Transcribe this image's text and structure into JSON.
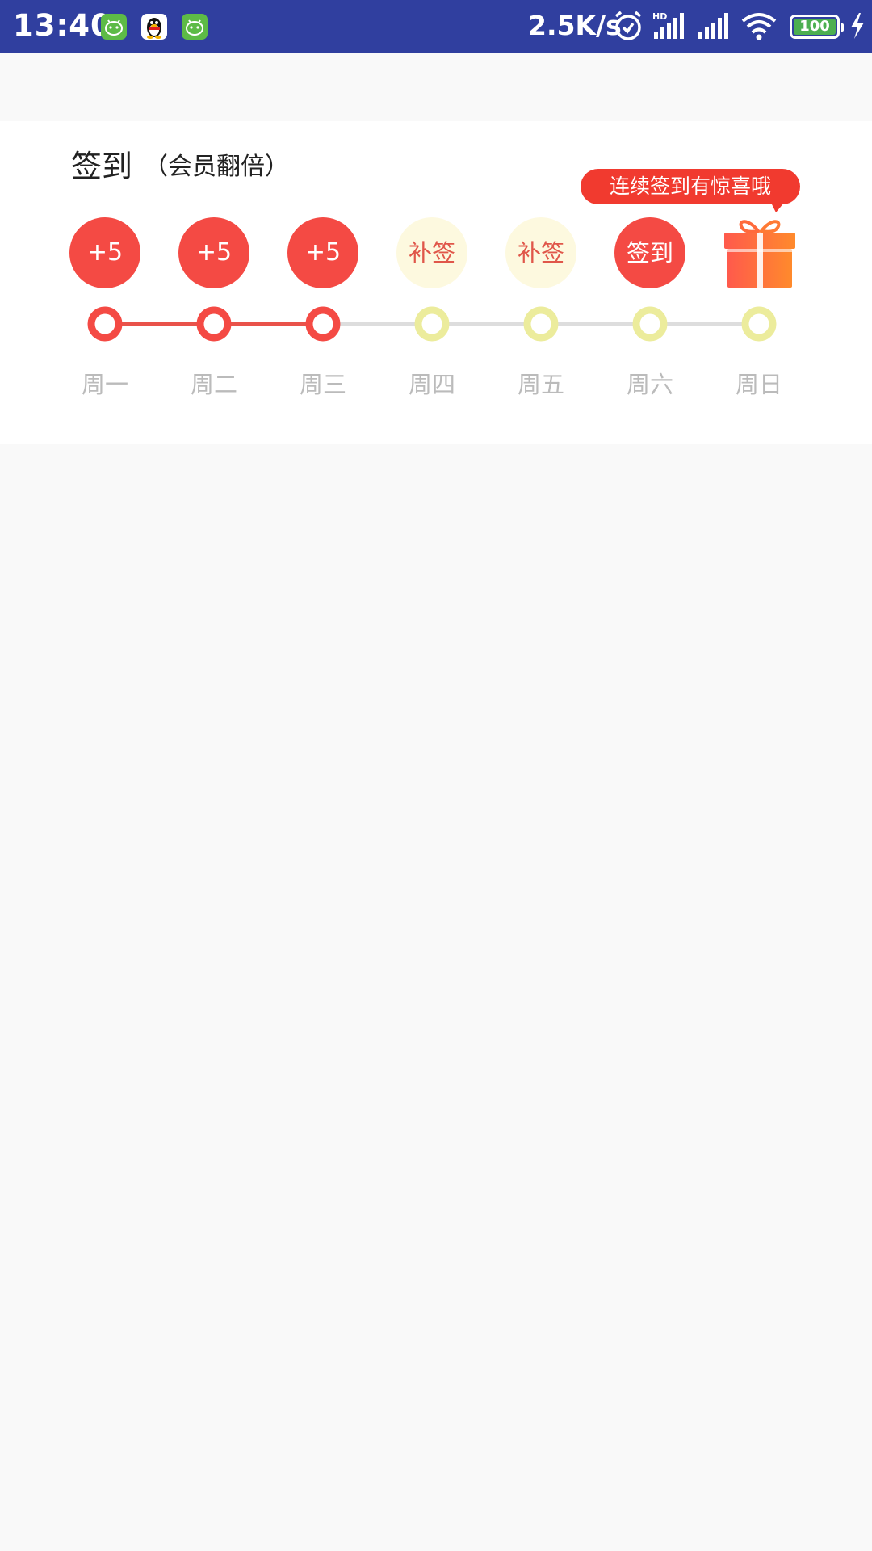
{
  "status_bar": {
    "time": "13:40",
    "speed": "2.5K/s",
    "battery_level": "100",
    "icons": [
      "android-app-icon",
      "qq-icon",
      "android-app-icon",
      "alarm-icon",
      "hd-signal-icon",
      "signal-icon",
      "wifi-icon",
      "battery-icon",
      "charging-icon"
    ]
  },
  "signin": {
    "title": "签到",
    "subtitle": "（会员翻倍）",
    "tooltip": "连续签到有惊喜哦",
    "days": [
      {
        "badge": "+5",
        "label": "周一",
        "state": "done"
      },
      {
        "badge": "+5",
        "label": "周二",
        "state": "done"
      },
      {
        "badge": "+5",
        "label": "周三",
        "state": "done"
      },
      {
        "badge": "补签",
        "label": "周四",
        "state": "makeup"
      },
      {
        "badge": "补签",
        "label": "周五",
        "state": "makeup"
      },
      {
        "badge": "签到",
        "label": "周六",
        "state": "today"
      },
      {
        "badge": "",
        "label": "周日",
        "state": "gift"
      }
    ],
    "reward_icon": "gift-icon"
  },
  "colors": {
    "status_bar": "#303f9f",
    "accent_red": "#f44a44",
    "makeup_bg": "#fdf9df",
    "pending_ring": "#ecec9c",
    "line_gray": "#dddddd",
    "label_gray": "#bbbbbb",
    "page_bg": "#f9f9f9"
  }
}
